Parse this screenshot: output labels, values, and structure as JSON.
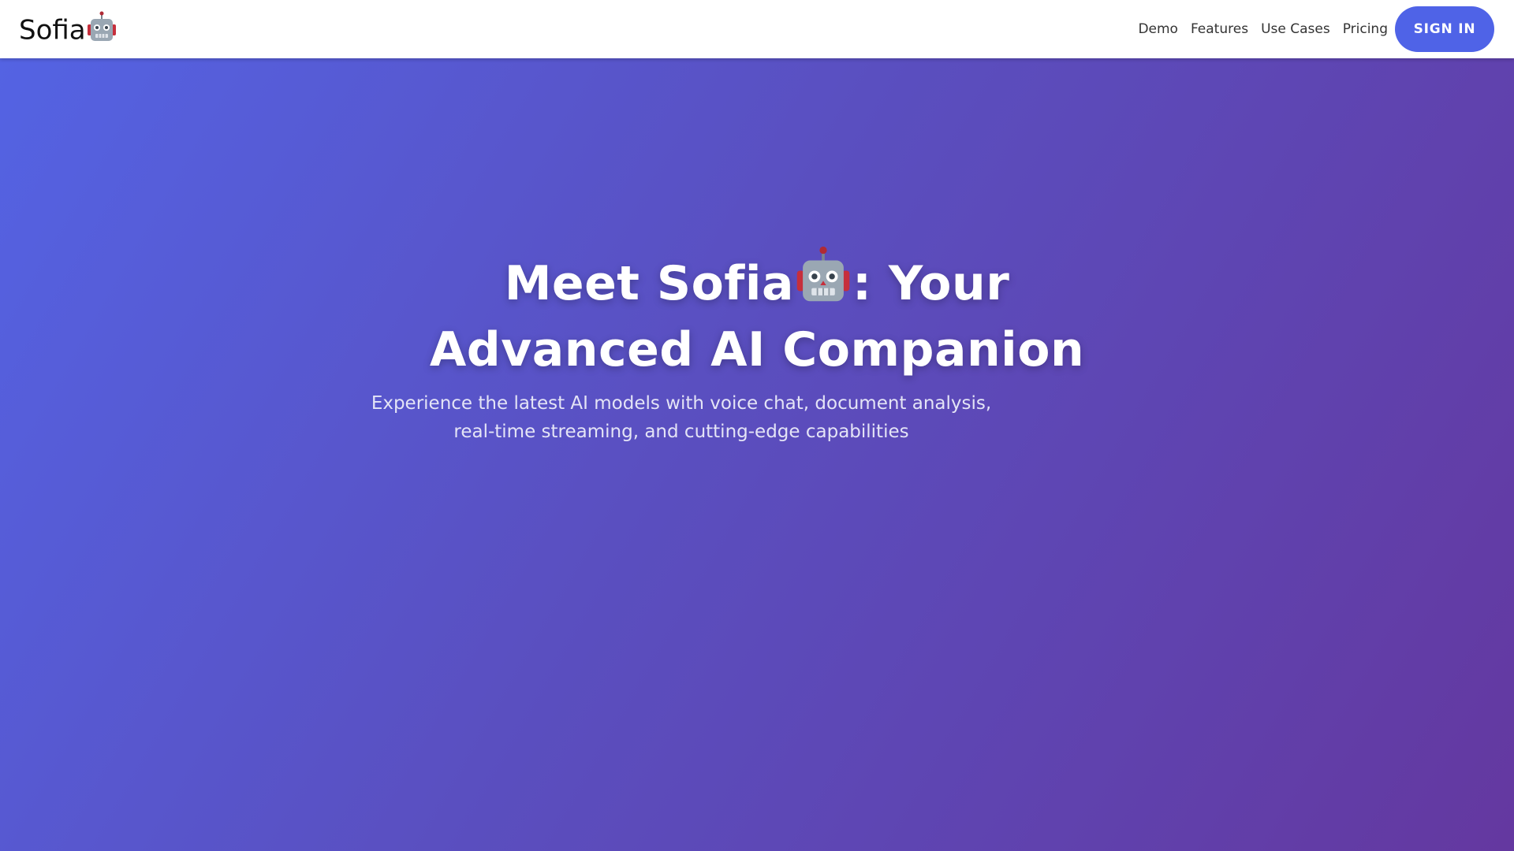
{
  "header": {
    "brand": "Sofia",
    "brand_icon": "robot-icon",
    "nav": [
      {
        "label": "Demo"
      },
      {
        "label": "Features"
      },
      {
        "label": "Use Cases"
      },
      {
        "label": "Pricing"
      }
    ],
    "signin_label": "SIGN IN"
  },
  "hero": {
    "title_part1": "Meet Sofia",
    "title_part2": ": Your",
    "title_line2": "Advanced AI Companion",
    "subtitle_line1": "Experience the latest AI models with voice chat, document analysis,",
    "subtitle_line2": "real-time streaming, and cutting-edge capabilities"
  },
  "colors": {
    "accent": "#4f63e7",
    "gradient_start": "#5463e3",
    "gradient_end": "#6438a0"
  }
}
